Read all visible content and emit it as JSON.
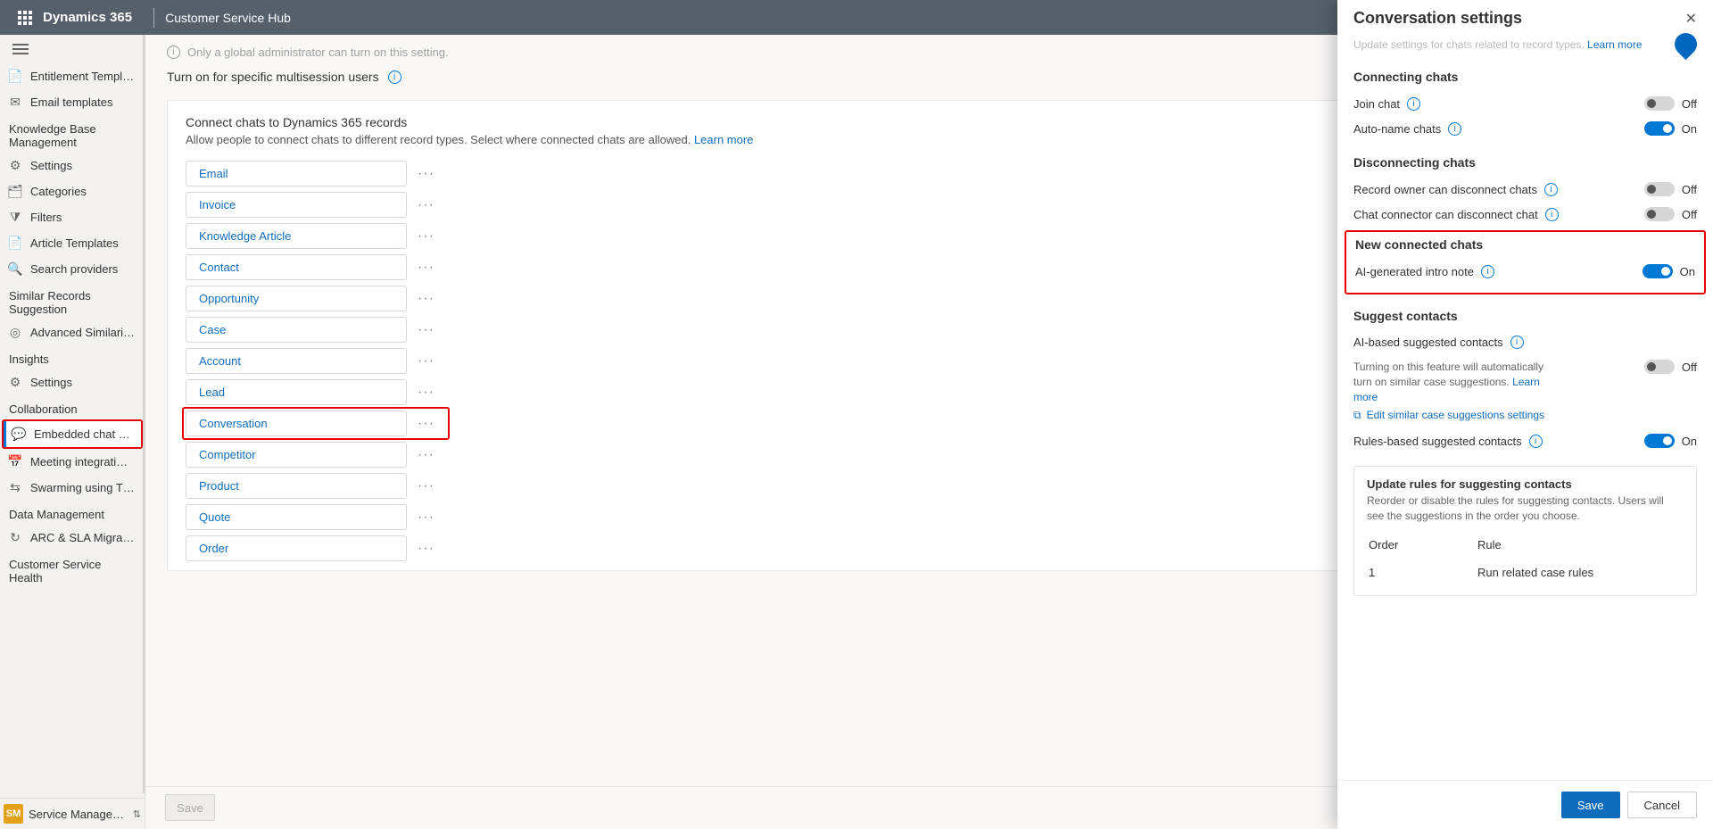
{
  "topbar": {
    "brand": "Dynamics 365",
    "app": "Customer Service Hub"
  },
  "sidebar": {
    "items_top": [
      {
        "icon": "📄",
        "label": "Entitlement Templ…"
      },
      {
        "icon": "✉",
        "label": "Email templates"
      }
    ],
    "groups": [
      {
        "title": "Knowledge Base Management",
        "items": [
          {
            "icon": "⚙",
            "label": "Settings"
          },
          {
            "icon": "🗂",
            "label": "Categories"
          },
          {
            "icon": "⧩",
            "label": "Filters"
          },
          {
            "icon": "📄",
            "label": "Article Templates"
          },
          {
            "icon": "🔍",
            "label": "Search providers"
          }
        ]
      },
      {
        "title": "Similar Records Suggestion",
        "items": [
          {
            "icon": "◎",
            "label": "Advanced Similari…"
          }
        ]
      },
      {
        "title": "Insights",
        "items": [
          {
            "icon": "⚙",
            "label": "Settings"
          }
        ]
      },
      {
        "title": "Collaboration",
        "items": [
          {
            "icon": "💬",
            "label": "Embedded chat u…",
            "active": true,
            "highlight": true
          },
          {
            "icon": "📅",
            "label": "Meeting integrati…"
          },
          {
            "icon": "⇆",
            "label": "Swarming using T…"
          }
        ]
      },
      {
        "title": "Data Management",
        "items": [
          {
            "icon": "↻",
            "label": "ARC & SLA Migra…"
          }
        ]
      },
      {
        "title": "Customer Service Health",
        "items": []
      }
    ],
    "area": {
      "badge": "SM",
      "label": "Service Managem…"
    }
  },
  "main": {
    "admin_note": "Only a global administrator can turn on this setting.",
    "turnon_label": "Turn on for specific multisession users",
    "card": {
      "title": "Connect chats to Dynamics 365 records",
      "subtitle": "Allow people to connect chats to different record types. Select where connected chats are allowed.",
      "learn_more": "Learn more",
      "records": [
        "Email",
        "Invoice",
        "Knowledge Article",
        "Contact",
        "Opportunity",
        "Case",
        "Account",
        "Lead",
        "Conversation",
        "Competitor",
        "Product",
        "Quote",
        "Order"
      ],
      "highlight_record": "Conversation"
    },
    "save_label": "Save"
  },
  "panel": {
    "title": "Conversation settings",
    "top_fragment": "Update settings for chats related to record types.",
    "learn_more": "Learn more",
    "sections": {
      "connecting": {
        "title": "Connecting chats",
        "rows": [
          {
            "label": "Join chat",
            "on": false
          },
          {
            "label": "Auto-name chats",
            "on": true
          }
        ]
      },
      "disconnecting": {
        "title": "Disconnecting chats",
        "rows": [
          {
            "label": "Record owner can disconnect chats",
            "on": false
          },
          {
            "label": "Chat connector can disconnect chat",
            "on": false
          }
        ]
      },
      "newconnected": {
        "title": "New connected chats",
        "rows": [
          {
            "label": "AI-generated intro note",
            "on": true
          }
        ]
      },
      "suggest": {
        "title": "Suggest contacts",
        "ai_label": "AI-based suggested contacts",
        "ai_on": false,
        "ai_hint": "Turning on this feature will automatically turn on similar case suggestions.",
        "ai_hint_link": "Learn more",
        "edit_link": "Edit similar case suggestions settings",
        "rules_label": "Rules-based suggested contacts",
        "rules_on": true
      }
    },
    "rules_card": {
      "title": "Update rules for suggesting contacts",
      "desc": "Reorder or disable the rules for suggesting contacts. Users will see the suggestions in the order you choose.",
      "col_order": "Order",
      "col_rule": "Rule",
      "rows": [
        {
          "order": "1",
          "rule": "Run related case rules"
        }
      ]
    },
    "on_text": "On",
    "off_text": "Off",
    "save": "Save",
    "cancel": "Cancel"
  }
}
